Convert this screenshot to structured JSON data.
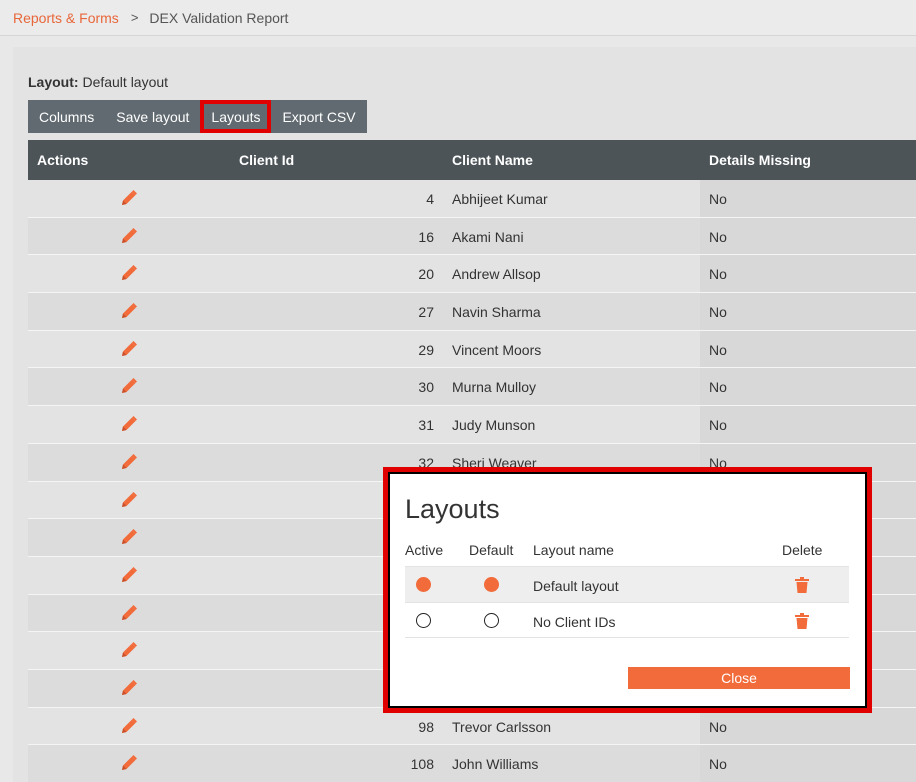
{
  "breadcrumb": {
    "parent": "Reports & Forms",
    "separator": ">",
    "current": "DEX Validation Report"
  },
  "layout_info": {
    "label": "Layout:",
    "value": "Default layout"
  },
  "toolbar": {
    "columns": "Columns",
    "save_layout": "Save layout",
    "layouts": "Layouts",
    "export_csv": "Export CSV"
  },
  "grid": {
    "headers": {
      "actions": "Actions",
      "client_id": "Client Id",
      "client_name": "Client Name",
      "details_missing": "Details Missing"
    },
    "rows": [
      {
        "id": "4",
        "name": "Abhijeet Kumar",
        "missing": "No"
      },
      {
        "id": "16",
        "name": "Akami Nani",
        "missing": "No"
      },
      {
        "id": "20",
        "name": "Andrew Allsop",
        "missing": "No"
      },
      {
        "id": "27",
        "name": "Navin Sharma",
        "missing": "No"
      },
      {
        "id": "29",
        "name": "Vincent Moors",
        "missing": "No"
      },
      {
        "id": "30",
        "name": "Murna Mulloy",
        "missing": "No"
      },
      {
        "id": "31",
        "name": "Judy Munson",
        "missing": "No"
      },
      {
        "id": "32",
        "name": "Sheri Weaver",
        "missing": "No"
      },
      {
        "id": "",
        "name": "",
        "missing": ""
      },
      {
        "id": "",
        "name": "",
        "missing": ""
      },
      {
        "id": "",
        "name": "",
        "missing": ""
      },
      {
        "id": "",
        "name": "",
        "missing": ""
      },
      {
        "id": "",
        "name": "",
        "missing": ""
      },
      {
        "id": "",
        "name": "",
        "missing": ""
      },
      {
        "id": "98",
        "name": "Trevor Carlsson",
        "missing": "No"
      },
      {
        "id": "108",
        "name": "John Williams",
        "missing": "No"
      }
    ]
  },
  "dialog": {
    "title": "Layouts",
    "headers": {
      "active": "Active",
      "default": "Default",
      "name": "Layout name",
      "delete": "Delete"
    },
    "rows": [
      {
        "name": "Default layout",
        "active": true,
        "default": true
      },
      {
        "name": "No Client IDs",
        "active": false,
        "default": false
      }
    ],
    "close_label": "Close"
  },
  "colors": {
    "accent": "#f26b3a",
    "highlight": "#e00000",
    "header_bg": "#4c5458",
    "toolbar_bg": "#606a70"
  }
}
